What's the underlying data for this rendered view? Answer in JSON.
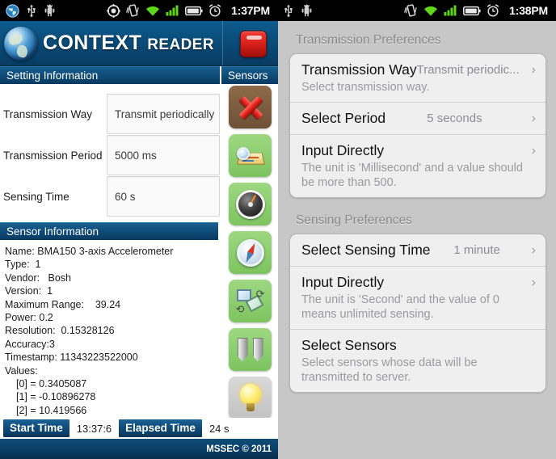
{
  "left_panel": {
    "statusbar": {
      "time": "1:37PM",
      "icons_left": [
        "globe-icon",
        "usb-icon",
        "android-debug-icon"
      ],
      "icons_right": [
        "gps-icon",
        "vibrate-icon",
        "wifi-icon",
        "signal-icon",
        "battery-icon",
        "alarm-icon"
      ]
    },
    "titlebar": {
      "logo": "globe-logo",
      "title_bold": "CONTEXT",
      "title_light": "READER",
      "stop_button": "stop-record-button"
    },
    "sections": {
      "setting_information": "Setting Information",
      "sensors": "Sensors",
      "sensor_information": "Sensor Information"
    },
    "settings_form": [
      {
        "label": "Transmission Way",
        "value": "Transmit periodically"
      },
      {
        "label": "Transmission Period",
        "value": "5000 ms"
      },
      {
        "label": "Sensing Time",
        "value": "60 s"
      }
    ],
    "sensor_rail": [
      {
        "name": "close-sensor-icon",
        "style": "red"
      },
      {
        "name": "location-map-sensor-icon",
        "style": "green"
      },
      {
        "name": "gauge-sensor-icon",
        "style": "green"
      },
      {
        "name": "compass-sensor-icon",
        "style": "green"
      },
      {
        "name": "orientation-sensor-icon",
        "style": "green"
      },
      {
        "name": "proximity-sensor-icon",
        "style": "green"
      },
      {
        "name": "light-sensor-icon",
        "style": "grey"
      }
    ],
    "sensor_information_lines": [
      {
        "text": "Name: BMA150 3-axis Accelerometer",
        "indent": false
      },
      {
        "text": "Type:  1",
        "indent": false
      },
      {
        "text": "Vendor:   Bosh",
        "indent": false
      },
      {
        "text": "Version:  1",
        "indent": false
      },
      {
        "text": "Maximum Range:    39.24",
        "indent": false
      },
      {
        "text": "Power: 0.2",
        "indent": false
      },
      {
        "text": "Resolution:  0.15328126",
        "indent": false
      },
      {
        "text": "Accuracy:3",
        "indent": false
      },
      {
        "text": "Timestamp: 11343223522000",
        "indent": false
      },
      {
        "text": "Values:",
        "indent": false
      },
      {
        "text": "[0] = 0.3405087",
        "indent": true
      },
      {
        "text": "[1] = -0.10896278",
        "indent": true
      },
      {
        "text": "[2] = 10.419566",
        "indent": true
      }
    ],
    "bottom": {
      "start_time_label": "Start Time",
      "start_time_value": "13:37:6",
      "elapsed_time_label": "Elapsed Time",
      "elapsed_time_value": "24 s"
    },
    "footer": "MSSEC © 2011"
  },
  "right_panel": {
    "statusbar": {
      "time": "1:38PM",
      "icons_left": [
        "usb-icon",
        "android-debug-icon"
      ],
      "icons_right": [
        "vibrate-icon",
        "wifi-icon",
        "signal-icon",
        "battery-icon",
        "alarm-icon"
      ]
    },
    "groups": [
      {
        "title": "Transmission Preferences",
        "cells": [
          {
            "title": "Transmission Way",
            "value": "Transmit periodic...",
            "value_inline": true,
            "sub": "Select transmission way.",
            "chevron": "chevron-right-icon"
          },
          {
            "title": "Select Period",
            "value": "5 seconds",
            "value_inline": false,
            "sub": "",
            "chevron": "chevron-right-icon"
          },
          {
            "title": "Input Directly",
            "value": "",
            "value_inline": false,
            "sub": "The unit is 'Millisecond' and a value should be more than 500.",
            "chevron": "chevron-right-icon"
          }
        ]
      },
      {
        "title": "Sensing Preferences",
        "cells": [
          {
            "title": "Select Sensing Time",
            "value": "1 minute",
            "value_inline": false,
            "sub": "",
            "chevron": "chevron-right-icon"
          },
          {
            "title": "Input Directly",
            "value": "",
            "value_inline": false,
            "sub": "The unit is 'Second' and the value of 0 means unlimited sensing.",
            "chevron": "chevron-right-icon"
          },
          {
            "title": "Select Sensors",
            "value": "",
            "value_inline": false,
            "sub": "Select sensors whose data will be transmitted to server.",
            "chevron": ""
          }
        ]
      }
    ]
  },
  "colors": {
    "android_header": "#0a4e7c",
    "section_bar": "#0f4d7a",
    "ios_bg": "#c7c7c7",
    "ios_card": "#efeff0",
    "accent_red": "#d61f18"
  }
}
